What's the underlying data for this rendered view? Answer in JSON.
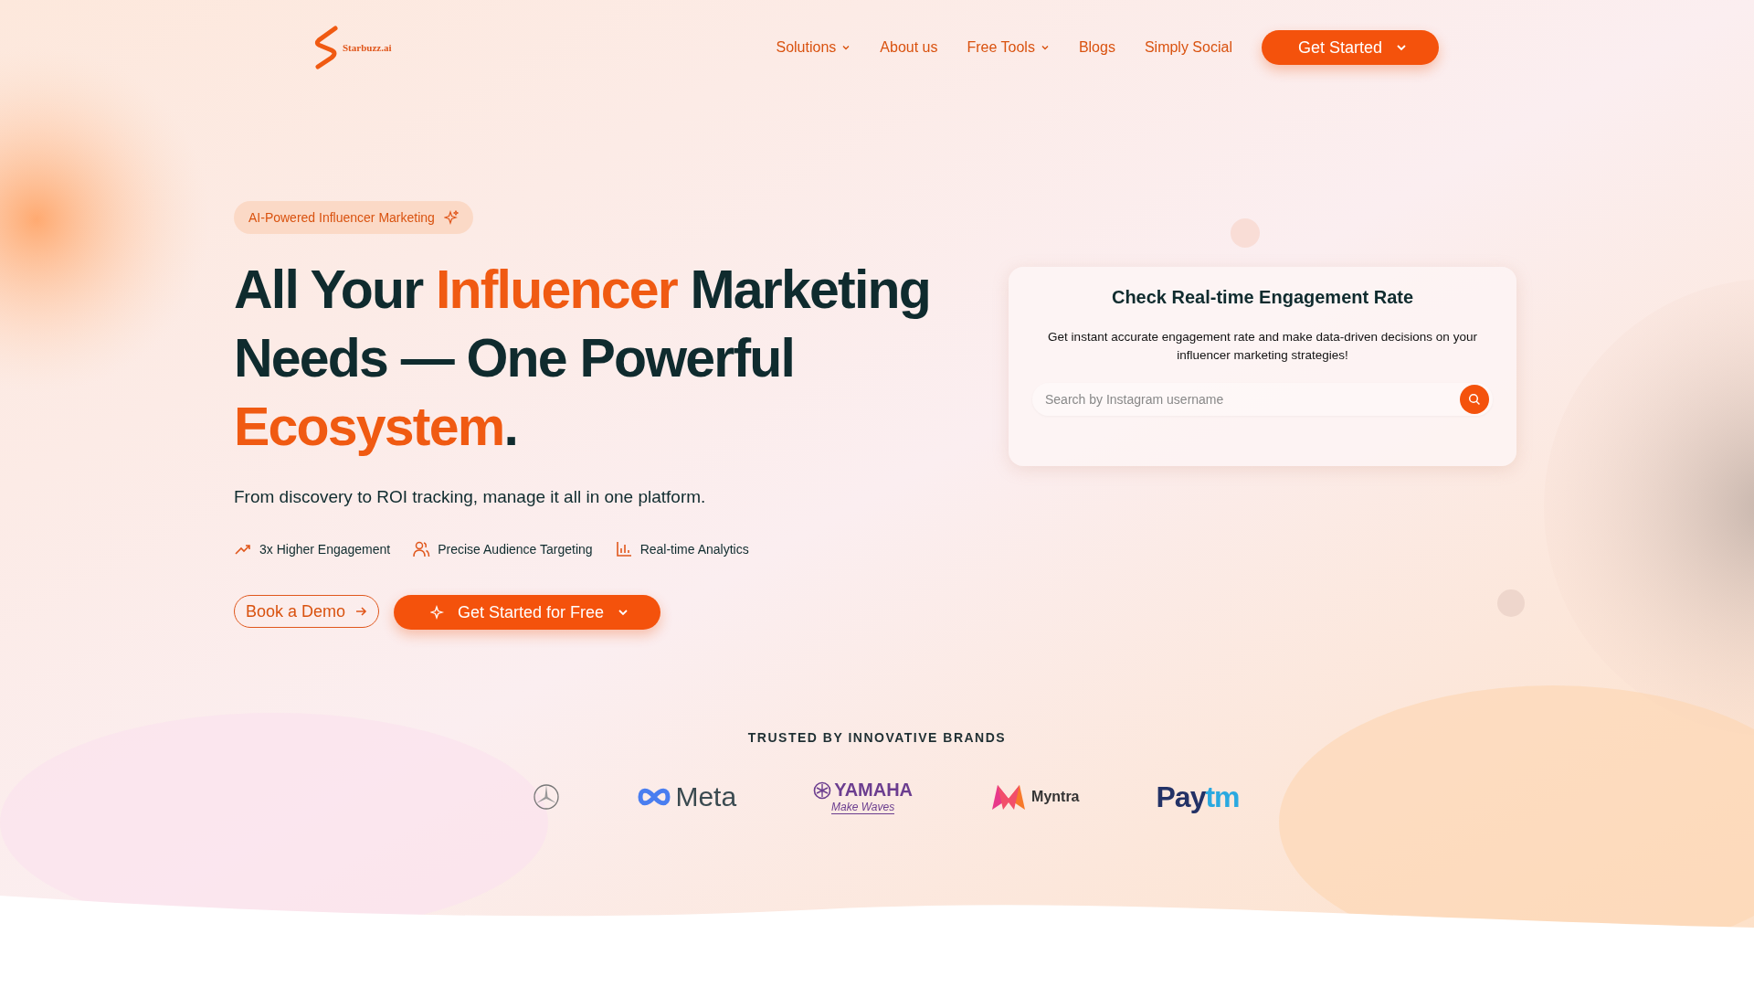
{
  "logo": {
    "name": "Starbuzz.ai"
  },
  "nav": [
    {
      "label": "Solutions",
      "dropdown": true
    },
    {
      "label": "About us",
      "dropdown": false
    },
    {
      "label": "Free Tools",
      "dropdown": true
    },
    {
      "label": "Blogs",
      "dropdown": false
    },
    {
      "label": "Simply Social",
      "dropdown": false
    }
  ],
  "nav_button": {
    "label": "Get Started"
  },
  "hero": {
    "badge": "AI-Powered Influencer Marketing",
    "heading": [
      {
        "text": "All Your ",
        "accent": false
      },
      {
        "text": "Influencer",
        "accent": true
      },
      {
        "text": " Marketing Needs — One Powerful ",
        "accent": false
      },
      {
        "text": "Ecosystem",
        "accent": true
      },
      {
        "text": ".",
        "accent": false
      }
    ],
    "subtitle": "From discovery to ROI tracking, manage it all in one platform.",
    "features": [
      {
        "kind": "trend",
        "label": "3x Higher Engagement"
      },
      {
        "kind": "people",
        "label": "Precise Audience Targeting"
      },
      {
        "kind": "chart",
        "label": "Real-time Analytics"
      }
    ],
    "demo_button": "Book a Demo",
    "start_button": "Get Started for Free"
  },
  "card": {
    "title": "Check Real-time Engagement Rate",
    "text": "Get instant accurate engagement rate and make data-driven decisions on your influencer marketing strategies!",
    "search": {
      "placeholder": "Search by Instagram username"
    }
  },
  "brands": {
    "title": "TRUSTED BY INNOVATIVE BRANDS",
    "items": [
      {
        "kind": "star"
      },
      {
        "kind": "meta",
        "name": "Meta"
      },
      {
        "kind": "yamaha",
        "name": "YAMAHA",
        "tagline": "Make Waves"
      },
      {
        "kind": "myntra",
        "name": "Myntra"
      },
      {
        "kind": "paytm",
        "name": "Pay",
        "name2": "tm"
      }
    ]
  }
}
